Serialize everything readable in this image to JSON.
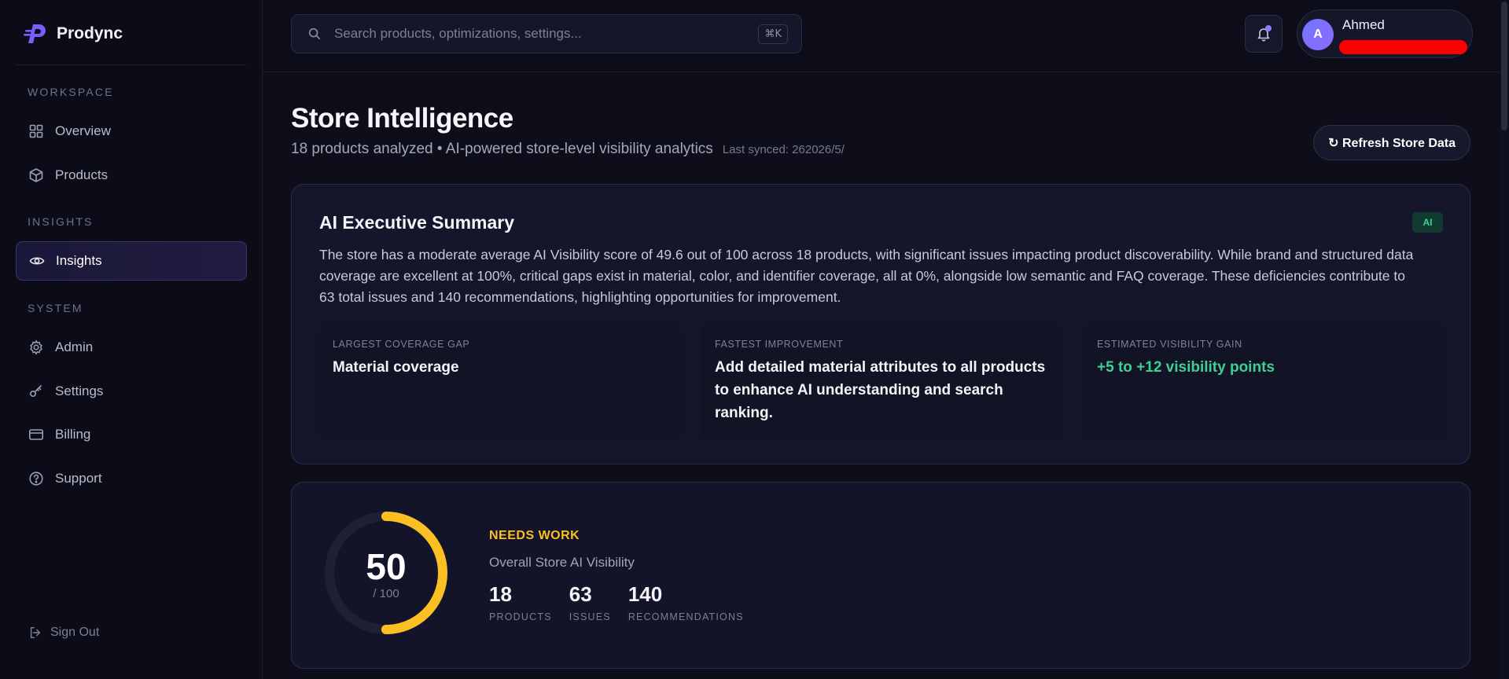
{
  "brand": {
    "name": "Prodync"
  },
  "sidebar": {
    "sections": {
      "workspace": "WORKSPACE",
      "insights": "INSIGHTS",
      "system": "SYSTEM"
    },
    "items": [
      {
        "label": "Overview",
        "icon": "grid-icon"
      },
      {
        "label": "Products",
        "icon": "box-icon"
      },
      {
        "label": "Insights",
        "icon": "eye-icon",
        "active": true
      },
      {
        "label": "Admin",
        "icon": "gear-icon"
      },
      {
        "label": "Settings",
        "icon": "key-icon"
      },
      {
        "label": "Billing",
        "icon": "credit-card-icon"
      },
      {
        "label": "Support",
        "icon": "help-circle-icon"
      }
    ],
    "signout": "Sign Out"
  },
  "topbar": {
    "search_placeholder": "Search products, optimizations, settings...",
    "shortcut": "⌘K",
    "user": {
      "initial": "A",
      "name": "Ahmed"
    }
  },
  "page": {
    "title": "Store Intelligence",
    "subtitle": "18 products analyzed • AI-powered store-level visibility analytics",
    "last_synced": "Last synced: 262026/5/",
    "refresh_label": "↻ Refresh Store Data"
  },
  "summary": {
    "title": "AI Executive Summary",
    "badge": "AI",
    "text": "The store has a moderate average AI Visibility score of 49.6 out of 100 across 18 products, with significant issues impacting product discoverability. While brand and structured data coverage are excellent at 100%, critical gaps exist in material, color, and identifier coverage, all at 0%, alongside low semantic and FAQ coverage. These deficiencies contribute to 63 total issues and 140 recommendations, highlighting opportunities for improvement.",
    "boxes": [
      {
        "label": "LARGEST COVERAGE GAP",
        "value": "Material coverage"
      },
      {
        "label": "FASTEST IMPROVEMENT",
        "value": "Add detailed material attributes to all products to enhance AI understanding and search ranking."
      },
      {
        "label": "ESTIMATED VISIBILITY GAIN",
        "value": "+5 to +12 visibility points"
      }
    ]
  },
  "score": {
    "value": "50",
    "max": "/ 100",
    "fraction": 0.5,
    "status": "NEEDS WORK",
    "status_color": "#fbbf24",
    "subtitle": "Overall Store AI Visibility",
    "stats": [
      {
        "value": "18",
        "label": "PRODUCTS"
      },
      {
        "value": "63",
        "label": "ISSUES"
      },
      {
        "value": "140",
        "label": "RECOMMENDATIONS"
      }
    ]
  },
  "colors": {
    "accent": "#7c6cff",
    "positive": "#3fcf94",
    "warning": "#fbbf24",
    "redaction": "#ff0000"
  }
}
